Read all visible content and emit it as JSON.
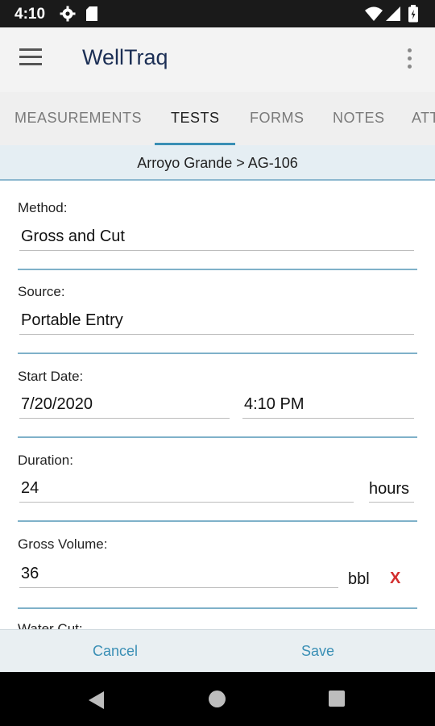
{
  "status_bar": {
    "time": "4:10"
  },
  "app_bar": {
    "title": "WellTraq"
  },
  "tabs": [
    {
      "label": "MEASUREMENTS"
    },
    {
      "label": "TESTS"
    },
    {
      "label": "FORMS"
    },
    {
      "label": "NOTES"
    },
    {
      "label": "ATT"
    }
  ],
  "breadcrumb": "Arroyo Grande > AG-106",
  "form": {
    "method": {
      "label": "Method:",
      "value": "Gross and Cut"
    },
    "source": {
      "label": "Source:",
      "value": "Portable Entry"
    },
    "start_date": {
      "label": "Start Date:",
      "date": "7/20/2020",
      "time": "4:10 PM"
    },
    "duration": {
      "label": "Duration:",
      "value": "24",
      "unit": "hours"
    },
    "gross_volume": {
      "label": "Gross Volume:",
      "value": "36",
      "unit": "bbl",
      "clear": "X"
    },
    "water_cut": {
      "label": "Water Cut:"
    }
  },
  "actions": {
    "cancel": "Cancel",
    "save": "Save"
  },
  "colors": {
    "accent": "#3a8fb5",
    "title": "#1c2f55",
    "clear": "#d32f2f"
  }
}
